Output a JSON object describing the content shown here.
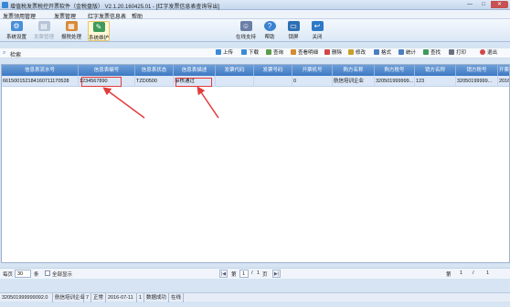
{
  "window": {
    "title": "增值税发票税控开票软件（金税盘版） V2.1.20.160425.01 - [红字发票信息表查询导出]",
    "minimize": "—",
    "maximize": "□",
    "close": "✕"
  },
  "menu": [
    "发票领用管理",
    "发票管理",
    "红字发票信息表",
    "帮助"
  ],
  "toolbar": {
    "system_settings": "系统设置",
    "invoice_mgmt": "发票管理",
    "tax_report": "报税处理",
    "system_maint": "系统维护",
    "online_support": "在线支持",
    "help": "帮助",
    "lock": "锁屏",
    "close": "关闭"
  },
  "search": {
    "label": "检索"
  },
  "actions": [
    "上传",
    "下载",
    "查询",
    "查看明细",
    "删除",
    "修改",
    "格式",
    "统计",
    "查找",
    "打印",
    "退出"
  ],
  "table": {
    "columns": [
      "信息表流水号",
      "信息表编号",
      "信息表状态",
      "信息表描述",
      "发票代码",
      "发票号码",
      "开票机号",
      "购方名称",
      "购方税号",
      "销方名称",
      "销方税号",
      "开票"
    ],
    "rows": [
      [
        "661500152184160711170528",
        "1234567890",
        "TZD0500",
        "审核通过",
        "",
        "",
        "0",
        "航信培训企业",
        "320501999999...",
        "123",
        "32050199999...",
        "2016"
      ]
    ]
  },
  "pager": {
    "per_page_label": "每页",
    "per_page_value": "30",
    "per_page_unit": "条",
    "show_all": "全部显示",
    "first": "|◀",
    "prev": "◀",
    "page_prefix": "第",
    "page_value": "1",
    "page_sep": "/",
    "page_total": "1",
    "page_suffix": "页",
    "next": "▶",
    "last": "▶|",
    "right_prefix": "第",
    "right_current": "1",
    "right_sep": "/",
    "right_total": "1"
  },
  "status": [
    "320501999999092.0",
    "航信培训企业",
    "7",
    "正常",
    "2016-07-11",
    "1",
    "数据成功",
    "在线"
  ]
}
